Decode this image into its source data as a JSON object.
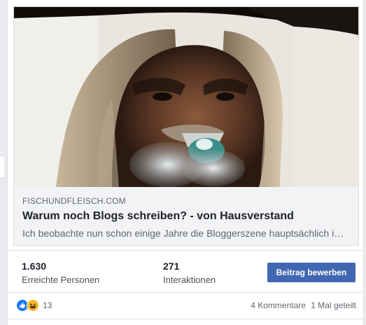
{
  "link_preview": {
    "domain": "FISCHUNDFLEISCH.COM",
    "title": "Warum noch Blogs schreiben? - von Hausverstand",
    "description": "Ich beobachte nun schon einige Jahre die Bloggerszene hauptsächlich im…"
  },
  "insights": {
    "reach_value": "1.630",
    "reach_label": "Erreichte Personen",
    "engagement_value": "271",
    "engagement_label": "Interaktionen",
    "boost_label": "Beitrag bewerben"
  },
  "footer": {
    "reactions_icons": [
      "like-icon",
      "haha-icon"
    ],
    "reactions_count": "13",
    "comments": "4 Kommentare",
    "shares": "1 Mal geteilt"
  },
  "colors": {
    "boost_button": "#4267b2",
    "like": "#1877f2",
    "haha": "#f7b928",
    "card_border": "#dddfe2",
    "page_bg": "#e9ebee"
  }
}
